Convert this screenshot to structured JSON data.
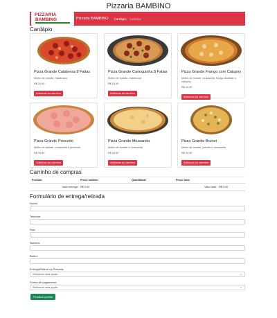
{
  "page_title": "Pizzaria BAMBINO",
  "navbar": {
    "logo_line1": "PIZZARIA",
    "logo_line2": "BAMBINO",
    "brand": "Pizzaria BAMBINO",
    "links": [
      "Cardápio",
      "Carrinho"
    ]
  },
  "menu": {
    "heading": "Cardápio",
    "add_label": "Adicionar ao carrinho",
    "items": [
      {
        "name": "Pizza Grande Calabresa 8 Fatias",
        "desc": "Molho de tomate, Calabresa.",
        "price": "R$ 24,90"
      },
      {
        "name": "Pizza Grande Carioquinha 8 Fatias",
        "desc": "Molho de tomate, Calabresa.",
        "price": "R$ 24,90"
      },
      {
        "name": "Pizza Grande Frango com Catupiry",
        "desc": "Molho de tomate, mussarela, frango desfiado e catupiry.",
        "price": "R$ 44,90"
      },
      {
        "name": "Pizza Grande Presunto",
        "desc": "Molho de tomate, mussarela e presunto.",
        "price": "R$ 34,90"
      },
      {
        "name": "Pizza Grande Mussarela",
        "desc": "Molho de tomate e mussarela",
        "price": "R$ 34,90"
      },
      {
        "name": "Pizza Grande Brunet",
        "desc": "Molho de tomate, palmito e mussarela",
        "price": "R$ 44,90"
      }
    ]
  },
  "cart": {
    "heading": "Carrinho de compras",
    "columns": [
      "Produto",
      "Preço unitário",
      "Quantidade",
      "Preço total"
    ],
    "delivery_label": "Valor entrega:",
    "delivery_value": "R$ 0,00",
    "total_label": "Valor total:",
    "total_value": "R$ 0,00"
  },
  "form": {
    "heading": "Formulário de entrega/retirada",
    "fields": [
      "Nome:",
      "Telefone:",
      "Rua:",
      "Número:",
      "Bairro:"
    ],
    "delivery_label": "Entrega/Retirar na Pizzaria:",
    "delivery_placeholder": "Selecione uma opção",
    "payment_label": "Forma de pagamento:",
    "payment_placeholder": "Selecione uma opção",
    "submit_label": "Finalizar pedido"
  },
  "colors": {
    "primary": "#dc3545",
    "success": "#198754"
  }
}
